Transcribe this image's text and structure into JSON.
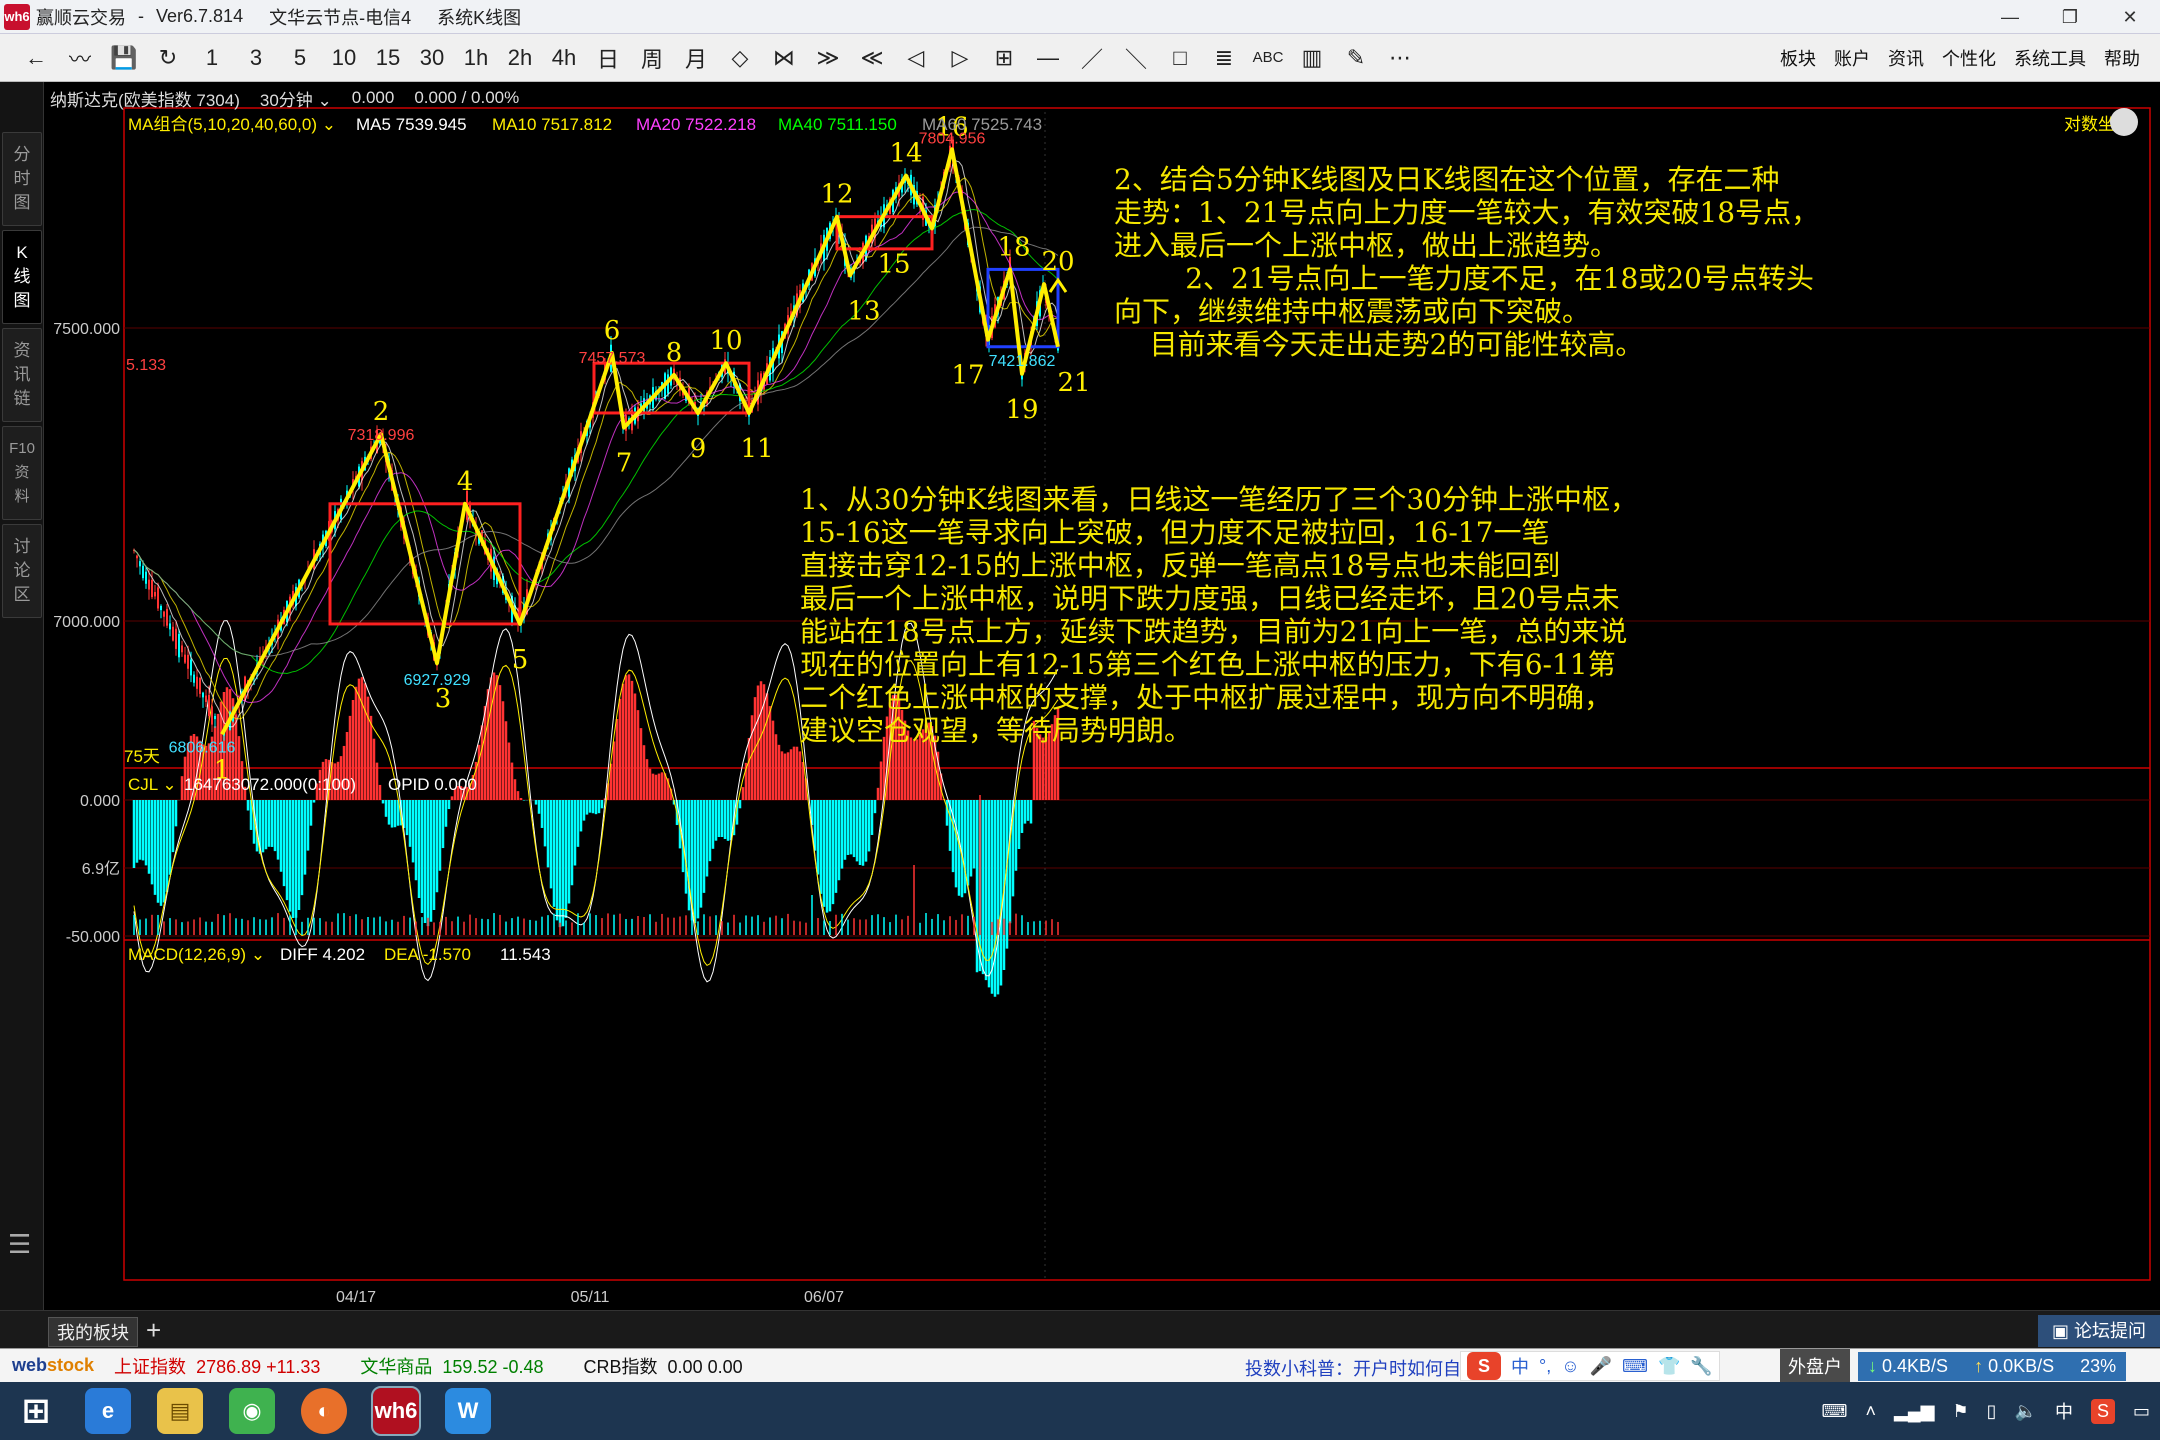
{
  "titlebar": {
    "app_name": "赢顺云交易",
    "separator": "-",
    "version": "Ver6.7.814",
    "node": "文华云节点-电信4",
    "mode": "系统K线图",
    "logo_text": "wh6"
  },
  "toolbar": {
    "buttons": [
      "←",
      "〰",
      "💾",
      "↻",
      "1",
      "3",
      "5",
      "10",
      "15",
      "30",
      "1h",
      "2h",
      "4h",
      "日",
      "周",
      "月",
      "◇",
      "⋈",
      "≫",
      "≪",
      "◁",
      "▷",
      "⊞",
      "—",
      "／",
      "＼",
      "□",
      "≣",
      "ABC",
      "▥",
      "✎",
      "⋯"
    ],
    "menu": [
      "板块",
      "账户",
      "资讯",
      "个性化",
      "系统工具",
      "帮助"
    ]
  },
  "leftnav": {
    "items": [
      "分\n时\n图",
      "K\n线\n图",
      "资\n讯\n链",
      "F10\n资\n料",
      "讨\n论\n区"
    ],
    "menu_icon": "hamburger-icon"
  },
  "info": {
    "symbol": "纳斯达克(欧美指数 7304)",
    "period": "30分钟",
    "price": "0.000",
    "change": "0.000 / 0.00%"
  },
  "ma": {
    "group": "MA组合(5,10,20,40,60,0)",
    "ma5": "MA5 7539.945",
    "ma10": "MA10 7517.812",
    "ma20": "MA20 7522.218",
    "ma40": "MA40 7511.150",
    "ma60": "MA60 7525.743",
    "log_label": "对数坐"
  },
  "colors": {
    "ma5": "#ffffff",
    "ma10": "#ffee00",
    "ma20": "#ff40ff",
    "ma40": "#00ff00",
    "ma60": "#9a9a9a",
    "pen": "#ffee00",
    "rise": "#ff3333",
    "fall": "#00ffff",
    "axis": "#cc0000",
    "center_box": "#ff2020",
    "blue_box": "#2040ff"
  },
  "chart_data": [
    {
      "type": "candlestick",
      "title": "纳斯达克(欧美指数 7304) 30分钟",
      "y_ticks": [
        "7500.000",
        "7000.000"
      ],
      "x_ticks": [
        "04/17",
        "05/11",
        "06/07"
      ],
      "days_label": "75天",
      "left_price_label": "5.133",
      "points": [
        {
          "id": "1",
          "price": 6806.616,
          "price_label": "6806.616"
        },
        {
          "id": "2",
          "price": 7318.996,
          "price_label": "7318.996"
        },
        {
          "id": "3",
          "price": 6927.929,
          "price_label": "6927.929"
        },
        {
          "id": "4",
          "price": 7200
        },
        {
          "id": "5",
          "price": 6995
        },
        {
          "id": "6",
          "price": 7457.573,
          "price_label": "7457.573"
        },
        {
          "id": "7",
          "price": 7330
        },
        {
          "id": "8",
          "price": 7420
        },
        {
          "id": "9",
          "price": 7355
        },
        {
          "id": "10",
          "price": 7440
        },
        {
          "id": "11",
          "price": 7355
        },
        {
          "id": "12",
          "price": 7690
        },
        {
          "id": "13",
          "price": 7590
        },
        {
          "id": "14",
          "price": 7760
        },
        {
          "id": "15",
          "price": 7670
        },
        {
          "id": "16",
          "price": 7804.956,
          "price_label": "7804.956"
        },
        {
          "id": "17",
          "price": 7480
        },
        {
          "id": "18",
          "price": 7600
        },
        {
          "id": "19",
          "price": 7421.862,
          "price_label": "7421.862"
        },
        {
          "id": "20",
          "price": 7575
        },
        {
          "id": "21",
          "price": 7468
        }
      ],
      "centers": [
        {
          "from": "2",
          "to": "5",
          "color": "red"
        },
        {
          "from": "6",
          "to": "11",
          "color": "red"
        },
        {
          "from": "12",
          "to": "15",
          "color": "red"
        },
        {
          "from": "17",
          "to": "21",
          "color": "blue"
        }
      ]
    },
    {
      "type": "bar",
      "title": "CJL",
      "header": "164763072.000(0:100)",
      "opid": "OPID 0.000",
      "y_ticks": [
        "6.9亿"
      ]
    },
    {
      "type": "bar",
      "title": "MACD(12,26,9)",
      "diff": "DIFF 4.202",
      "dea": "DEA -1.570",
      "macd": "11.543",
      "y_ticks": [
        "0.000",
        "-50.000"
      ]
    }
  ],
  "annotation_a": "2、结合5分钟K线图及日K线图在这个位置，存在二种\n走势：1、21号点向上力度一笔较大，有效突破18号点，\n进入最后一个上涨中枢，做出上涨趋势。\n        2、21号点向上一笔力度不足，在18或20号点转头\n向下，继续维持中枢震荡或向下突破。\n    目前来看今天走出走势2的可能性较高。",
  "annotation_b": "1、从30分钟K线图来看，日线这一笔经历了三个30分钟上涨中枢，\n15-16这一笔寻求向上突破，但力度不足被拉回，16-17一笔\n直接击穿12-15的上涨中枢，反弹一笔高点18号点也未能回到\n最后一个上涨中枢，说明下跌力度强，日线已经走坏，且20号点未\n能站在18号点上方，延续下跌趋势，目前为21向上一笔，总的来说\n现在的位置向上有12-15第三个红色上涨中枢的压力，下有6-11第\n二个红色上涨中枢的支撑，处于中枢扩展过程中，现方向不明确，\n建议空仓观望，等待局势明朗。",
  "tabbar": {
    "tab": "我的板块",
    "add": "+",
    "forum": "论坛提问"
  },
  "status": {
    "logo_a": "web",
    "logo_b": "stock",
    "sh_name": "上证指数",
    "sh_value": "2786.89",
    "sh_change": "+11.33",
    "wh_name": "文华商品",
    "wh_value": "159.52",
    "wh_change": "-0.48",
    "crb_name": "CRB指数",
    "crb_value": "0.00",
    "crb_change": "0.00",
    "tip": "投数小科普：开户时如何自",
    "ime_lang": "中",
    "outer": "外盘户",
    "down": "0.4KB/S",
    "up": "0.0KB/S",
    "pct": "23%"
  },
  "taskbar": {
    "tray_lang": "中",
    "apps": [
      "windows-icon",
      "ie-icon",
      "explorer-icon",
      "wechat-icon",
      "browser-icon",
      "wh6-icon",
      "w-app-icon"
    ]
  }
}
